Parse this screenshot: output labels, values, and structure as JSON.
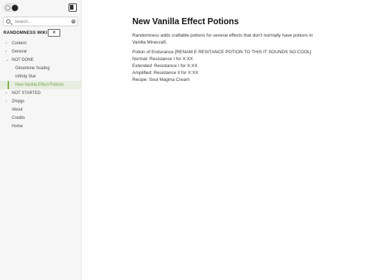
{
  "sidebar": {
    "search_placeholder": "Search...",
    "site_title": "RANDOMNESS WIKI",
    "collapse_label": "✕",
    "items": [
      {
        "label": "Content",
        "chevron": "›"
      },
      {
        "label": "General",
        "chevron": "›"
      },
      {
        "label": "NOT DONE",
        "chevron": "⌄"
      },
      {
        "label": "Glowstone Scaling"
      },
      {
        "label": "Infinity Star"
      },
      {
        "label": "New Vanilla Effect Potions"
      },
      {
        "label": "NOT STARTED",
        "chevron": "›"
      },
      {
        "label": "Zmpgs",
        "chevron": "›"
      },
      {
        "label": "About"
      },
      {
        "label": "Credits"
      },
      {
        "label": "Home"
      }
    ]
  },
  "article": {
    "title": "New Vanilla Effect Potions",
    "intro": "Randomness adds craftable potions for several effects that don't normally have potions in Vanilla Minecraft.",
    "lines": [
      "Potion of Endurance [RENAM E RESITANCE POTION TO THIS IT SOUNDS SO COOL]",
      "Normal: Resistance I for X:XX",
      "Extended: Resistance I for X:XX",
      "Amplified: Resistance II for X:XX",
      "Recipe: Soul Magma Cream"
    ]
  },
  "colors": {
    "accent": "#7cb342",
    "sidebar_bg": "#f6f6f6"
  }
}
